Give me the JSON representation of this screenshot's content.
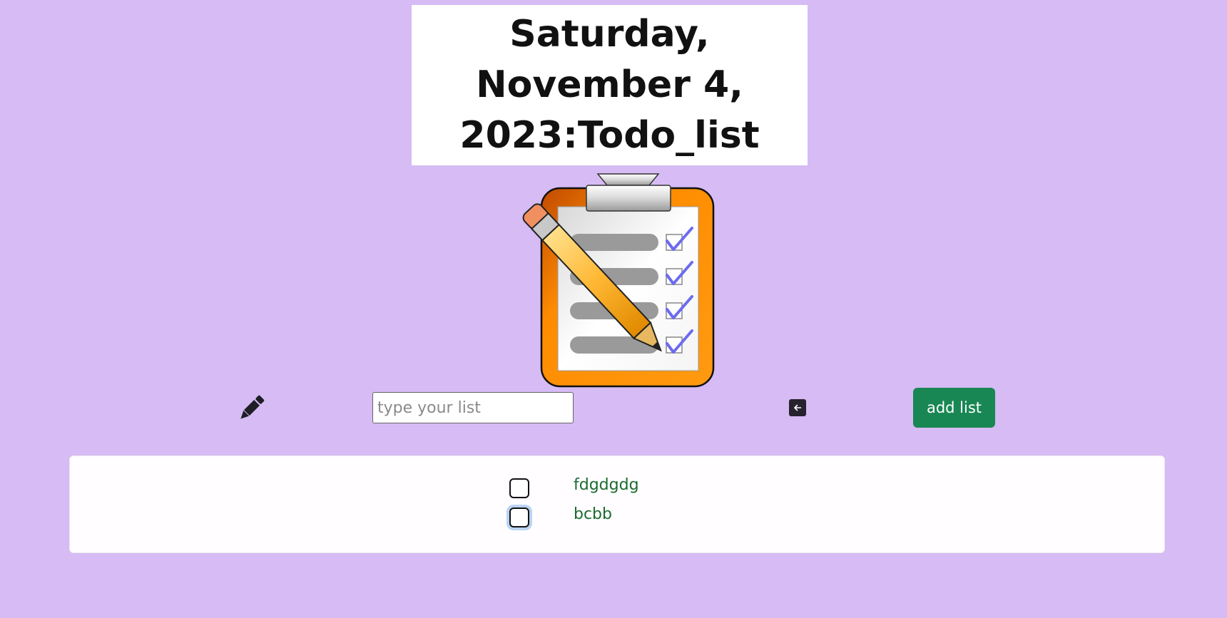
{
  "header": {
    "title": "Saturday, November 4, 2023:Todo_list"
  },
  "input": {
    "placeholder": "type your list",
    "value": ""
  },
  "add_button_label": "add list",
  "todo_items": [
    {
      "text": "fdgdgdg",
      "checked": false
    },
    {
      "text": "bcbb",
      "checked": false
    }
  ],
  "icons": {
    "clipboard": "clipboard-checklist-icon",
    "pencil": "pencil-icon",
    "enter": "arrow-left-icon"
  },
  "colors": {
    "background": "#d6bbf4",
    "button": "#198754",
    "item_text": "#1b6b30"
  }
}
